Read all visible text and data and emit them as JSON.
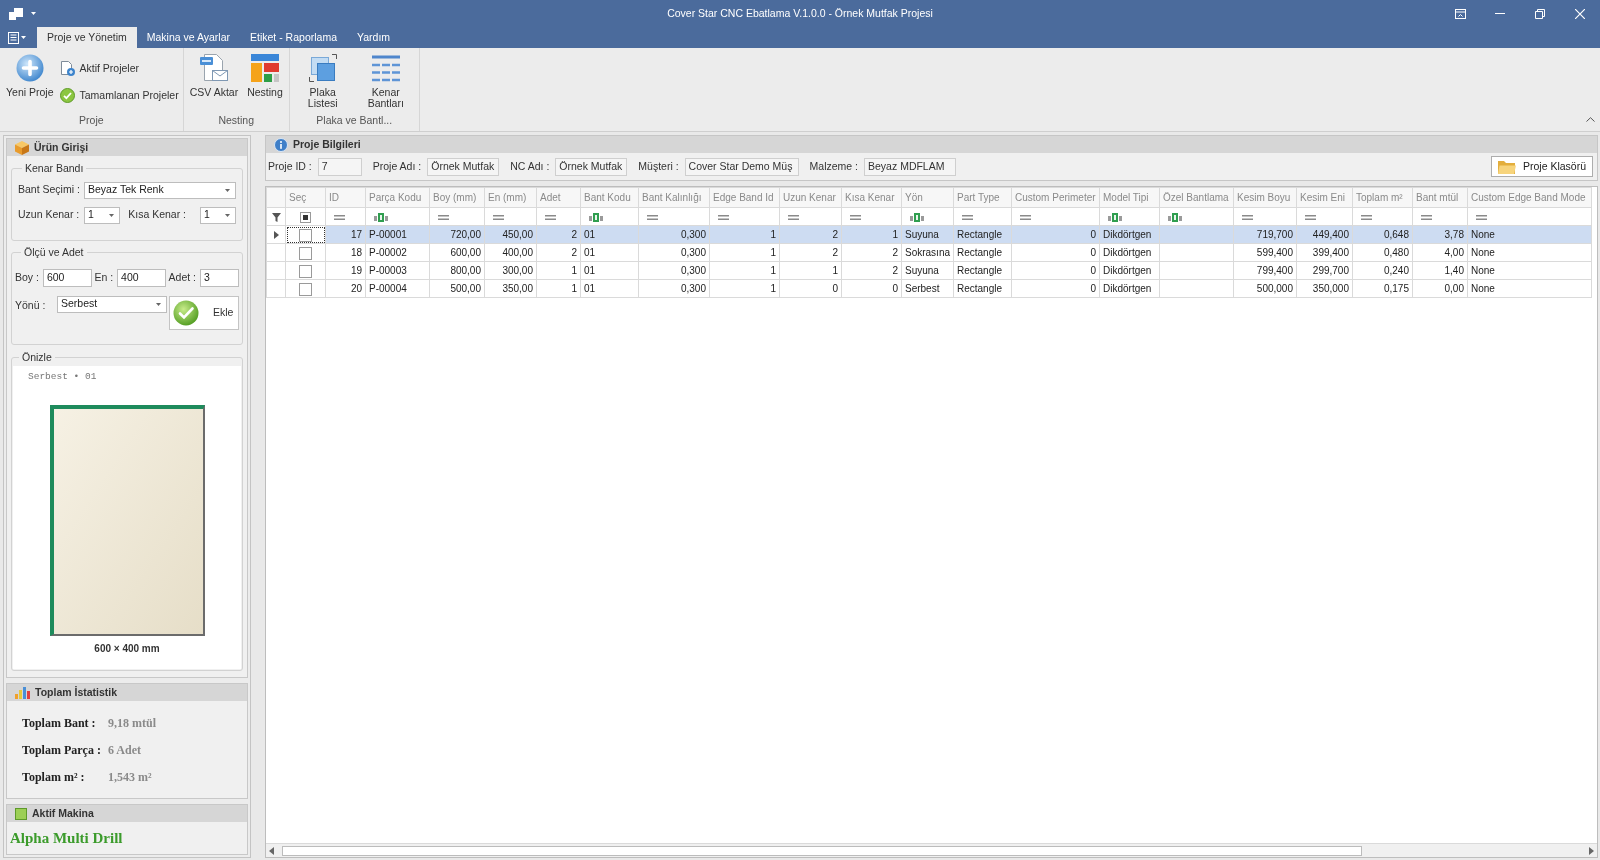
{
  "window": {
    "title": "Cover Star CNC Ebatlama V.1.0.0 - Örnek Mutfak Projesi"
  },
  "ribbon": {
    "tabs": [
      {
        "label": "Proje ve Yönetim",
        "selected": true
      },
      {
        "label": "Makina ve Ayarlar",
        "selected": false
      },
      {
        "label": "Etiket - Raporlama",
        "selected": false
      },
      {
        "label": "Yardım",
        "selected": false
      }
    ],
    "groups": [
      {
        "label": "Proje",
        "items": [
          {
            "kind": "large",
            "label": "Yeni Proje"
          },
          {
            "kind": "small",
            "label": "Aktif Projeler"
          },
          {
            "kind": "small",
            "label": "Tamamlanan Projeler"
          }
        ]
      },
      {
        "label": "Nesting",
        "items": [
          {
            "kind": "large",
            "label": "CSV Aktar"
          },
          {
            "kind": "large",
            "label": "Nesting"
          }
        ]
      },
      {
        "label": "Plaka ve Bantl...",
        "items": [
          {
            "kind": "large",
            "label": "Plaka Listesi"
          },
          {
            "kind": "large",
            "label": "Kenar Bantları"
          }
        ]
      }
    ]
  },
  "product_entry": {
    "title": "Ürün Girişi",
    "edge_band": {
      "title": "Kenar Bandı",
      "band": {
        "label": "Bant Seçimi :",
        "value": "Beyaz Tek Renk"
      },
      "long_edge": {
        "label": "Uzun Kenar :",
        "value": "1"
      },
      "short_edge": {
        "label": "Kısa Kenar :",
        "value": "1"
      }
    },
    "dimensions": {
      "title": "Ölçü ve Adet",
      "fields": [
        {
          "label": "Boy :",
          "value": "600"
        },
        {
          "label": "En :",
          "value": "400"
        },
        {
          "label": "Adet :",
          "value": "3"
        }
      ],
      "direction": {
        "label": "Yönü :",
        "value": "Serbest"
      },
      "add_button": "Ekle"
    },
    "preview": {
      "title": "Önizle",
      "caption": "Serbest • 01",
      "size_label": "600 × 400 mm",
      "banded_edges": {
        "top": true,
        "right": false,
        "bottom": false,
        "left": true
      }
    }
  },
  "statistics": {
    "title": "Toplam İstatistik",
    "items": [
      {
        "label": "Toplam Bant :",
        "value": "9,18 mtül"
      },
      {
        "label": "Toplam Parça :",
        "value": "6 Adet"
      },
      {
        "label": "Toplam m² :",
        "value": "1,543 m²"
      }
    ]
  },
  "active_machine": {
    "title": "Aktif Makina",
    "name": "Alpha Multi Drill"
  },
  "project_info": {
    "title": "Proje Bilgileri",
    "fields": [
      {
        "label": "Proje ID :",
        "value": "7"
      },
      {
        "label": "Proje Adı :",
        "value": "Örnek Mutfak"
      },
      {
        "label": "NC Adı :",
        "value": "Örnek Mutfak"
      },
      {
        "label": "Müşteri :",
        "value": "Cover Star Demo Müş"
      },
      {
        "label": "Malzeme :",
        "value": "Beyaz MDFLAM"
      }
    ],
    "folder_button": "Proje Klasörü"
  },
  "table": {
    "columns": [
      {
        "label": "Seç",
        "kind": "checkbox"
      },
      {
        "label": "ID",
        "kind": "number"
      },
      {
        "label": "Parça Kodu",
        "kind": "text"
      },
      {
        "label": "Boy (mm)",
        "kind": "number"
      },
      {
        "label": "En (mm)",
        "kind": "number"
      },
      {
        "label": "Adet",
        "kind": "number"
      },
      {
        "label": "Bant Kodu",
        "kind": "text"
      },
      {
        "label": "Bant Kalınlığı",
        "kind": "number"
      },
      {
        "label": "Edge Band Id",
        "kind": "number"
      },
      {
        "label": "Uzun Kenar",
        "kind": "number"
      },
      {
        "label": "Kısa Kenar",
        "kind": "number"
      },
      {
        "label": "Yön",
        "kind": "text"
      },
      {
        "label": "Part Type",
        "kind": "enum"
      },
      {
        "label": "Custom Perimeter",
        "kind": "number"
      },
      {
        "label": "Model Tipi",
        "kind": "text"
      },
      {
        "label": "Özel Bantlama",
        "kind": "text"
      },
      {
        "label": "Kesim Boyu",
        "kind": "number"
      },
      {
        "label": "Kesim Eni",
        "kind": "number"
      },
      {
        "label": "Toplam m²",
        "kind": "number"
      },
      {
        "label": "Bant mtül",
        "kind": "number"
      },
      {
        "label": "Custom Edge Band Mode",
        "kind": "enum"
      }
    ],
    "select_all": {
      "indeterminate": true
    },
    "rows": [
      {
        "selected": true,
        "checked": false,
        "cells": [
          null,
          "17",
          "P-00001",
          "720,00",
          "450,00",
          "2",
          "01",
          "0,300",
          "1",
          "2",
          "1",
          "Suyuna",
          "Rectangle",
          "0",
          "Dikdörtgen",
          null,
          "719,700",
          "449,400",
          "0,648",
          "3,78",
          "None"
        ]
      },
      {
        "selected": false,
        "checked": false,
        "cells": [
          null,
          "18",
          "P-00002",
          "600,00",
          "400,00",
          "2",
          "01",
          "0,300",
          "1",
          "2",
          "2",
          "Sokrasına",
          "Rectangle",
          "0",
          "Dikdörtgen",
          null,
          "599,400",
          "399,400",
          "0,480",
          "4,00",
          "None"
        ]
      },
      {
        "selected": false,
        "checked": false,
        "cells": [
          null,
          "19",
          "P-00003",
          "800,00",
          "300,00",
          "1",
          "01",
          "0,300",
          "1",
          "1",
          "2",
          "Suyuna",
          "Rectangle",
          "0",
          "Dikdörtgen",
          null,
          "799,400",
          "299,700",
          "0,240",
          "1,40",
          "None"
        ]
      },
      {
        "selected": false,
        "checked": false,
        "cells": [
          null,
          "20",
          "P-00004",
          "500,00",
          "350,00",
          "1",
          "01",
          "0,300",
          "1",
          "0",
          "0",
          "Serbest",
          "Rectangle",
          "0",
          "Dikdörtgen",
          null,
          "500,000",
          "350,000",
          "0,175",
          "0,00",
          "None"
        ]
      }
    ]
  }
}
